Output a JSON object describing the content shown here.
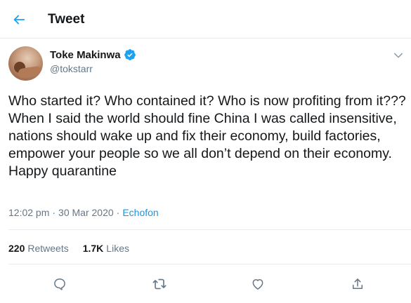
{
  "header": {
    "title": "Tweet"
  },
  "tweet": {
    "author": {
      "display_name": "Toke Makinwa",
      "handle": "@tokstarr"
    },
    "text": "Who started it? Who contained it? Who is now profiting from it??? When I said the world should fine China I was called insensitive, nations should wake up and fix their economy, build factories, empower your people so we all don’t depend on their economy. Happy quarantine",
    "time": "12:02 pm",
    "date": "30 Mar 2020",
    "separator": "·",
    "source": "Echofon",
    "stats": {
      "retweets_count": "220",
      "retweets_label": "Retweets",
      "likes_count": "1.7K",
      "likes_label": "Likes"
    }
  },
  "colors": {
    "accent": "#1da1f2",
    "text": "#14171a",
    "secondary": "#657786",
    "border": "#e6ecf0"
  },
  "icons": [
    "back-arrow-icon",
    "verified-badge-icon",
    "chevron-down-icon",
    "reply-icon",
    "retweet-icon",
    "like-icon",
    "share-icon"
  ]
}
